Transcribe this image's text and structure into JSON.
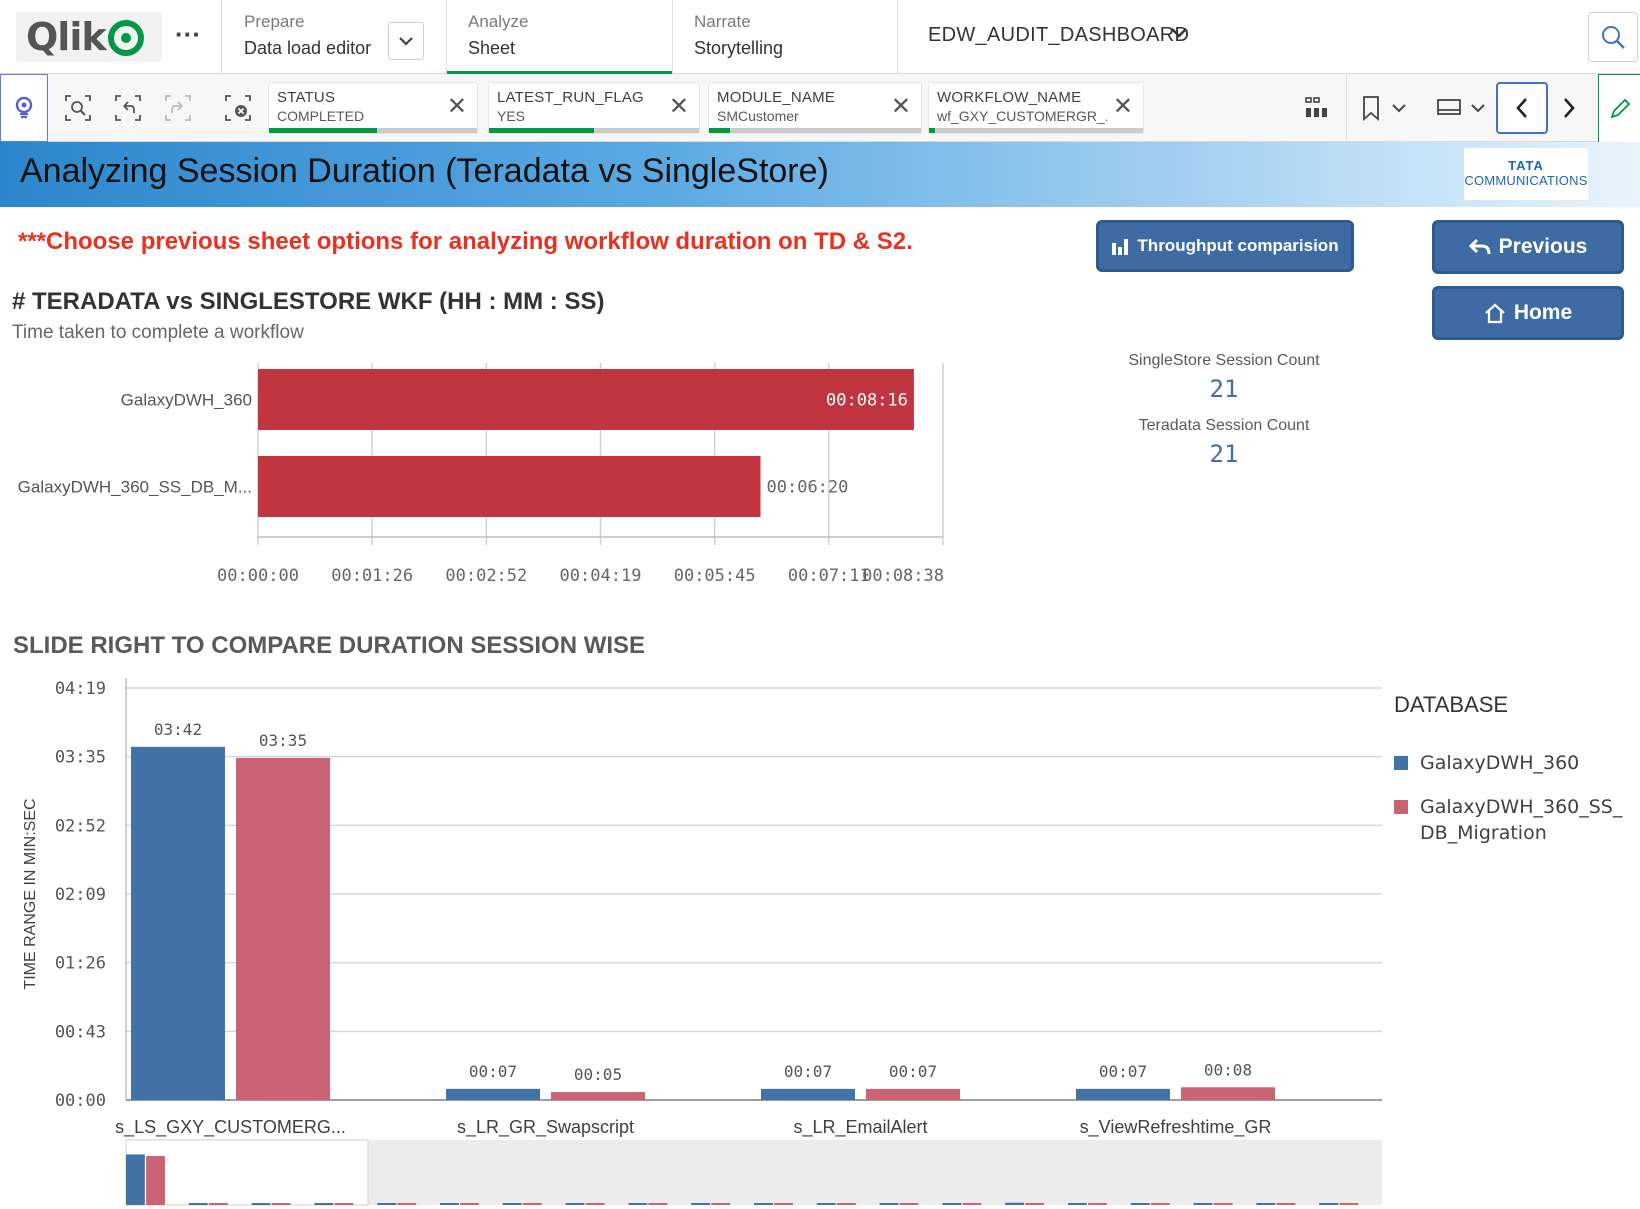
{
  "nav": {
    "prepare": {
      "label": "Prepare",
      "value": "Data load editor"
    },
    "analyze": {
      "label": "Analyze",
      "value": "Sheet"
    },
    "narrate": {
      "label": "Narrate",
      "value": "Storytelling"
    },
    "app_name": "EDW_AUDIT_DASHBOARD",
    "more": "···"
  },
  "selections": [
    {
      "field": "STATUS",
      "value": "COMPLETED"
    },
    {
      "field": "LATEST_RUN_FLAG",
      "value": "YES"
    },
    {
      "field": "MODULE_NAME",
      "value": "SMCustomer"
    },
    {
      "field": "WORKFLOW_NAME",
      "value": "wf_GXY_CUSTOMERGR_..."
    }
  ],
  "sheet": {
    "title": "Analyzing Session Duration (Teradata vs SingleStore)",
    "logo_line1": "TATA",
    "logo_line2": "COMMUNICATIONS",
    "notice": "***Choose previous sheet options for analyzing workflow duration on TD & S2."
  },
  "buttons": {
    "throughput": "Throughput comparision",
    "previous": "Previous",
    "home": "Home"
  },
  "kpis": [
    {
      "label": "SingleStore Session Count",
      "value": "21"
    },
    {
      "label": "Teradata Session Count",
      "value": "21"
    }
  ],
  "colors": {
    "accent": "#009845",
    "bar_red": "#c13540",
    "series_blue": "#4372a7",
    "series_pink": "#cc6374",
    "button_blue": "#3e6ba3",
    "notice_red": "#e8321f"
  },
  "chart_data": [
    {
      "type": "bar",
      "orientation": "horizontal",
      "title": "# TERADATA vs SINGLESTORE WKF (HH : MM : SS)",
      "subtitle": "Time taken to complete a workflow",
      "categories": [
        "GalaxyDWH_360",
        "GalaxyDWH_360_SS_DB_M..."
      ],
      "values_seconds": [
        496,
        380
      ],
      "data_labels": [
        "00:08:16",
        "00:06:20"
      ],
      "x_ticks": [
        "00:00:00",
        "00:01:26",
        "00:02:52",
        "00:04:19",
        "00:05:45",
        "00:07:11",
        "00:08:38"
      ],
      "x_range_seconds": [
        0,
        518
      ],
      "grid": true
    },
    {
      "type": "bar",
      "title": "SLIDE RIGHT TO COMPARE DURATION SESSION WISE",
      "ylabel": "TIME RANGE IN MIN:SEC",
      "legend_title": "DATABASE",
      "legend_position": "right",
      "categories": [
        "s_LS_GXY_CUSTOMERG...",
        "s_LR_GR_Swapscript",
        "s_LR_EmailAlert",
        "s_ViewRefreshtime_GR"
      ],
      "series": [
        {
          "name": "GalaxyDWH_360",
          "values_seconds": [
            222,
            7,
            7,
            7
          ],
          "data_labels": [
            "03:42",
            "00:07",
            "00:07",
            "00:07"
          ]
        },
        {
          "name": "GalaxyDWH_360_SS_DB_Migration",
          "values_seconds": [
            215,
            5,
            7,
            8
          ],
          "data_labels": [
            "03:35",
            "00:05",
            "00:07",
            "00:08"
          ]
        }
      ],
      "y_ticks": [
        "00:00",
        "00:43",
        "01:26",
        "02:09",
        "02:52",
        "03:35",
        "04:19"
      ],
      "y_range_seconds": [
        0,
        259
      ],
      "grid": true,
      "minichart": {
        "series_blue_values_seconds": [
          222,
          7,
          7,
          7,
          5,
          5,
          5,
          5,
          5,
          5,
          4,
          6,
          6,
          5,
          10,
          6,
          6,
          5,
          5,
          4
        ],
        "series_pink_values_seconds": [
          215,
          5,
          7,
          8,
          4,
          5,
          5,
          5,
          5,
          4,
          4,
          5,
          4,
          5,
          5,
          5,
          4,
          4,
          5,
          4
        ]
      }
    }
  ]
}
